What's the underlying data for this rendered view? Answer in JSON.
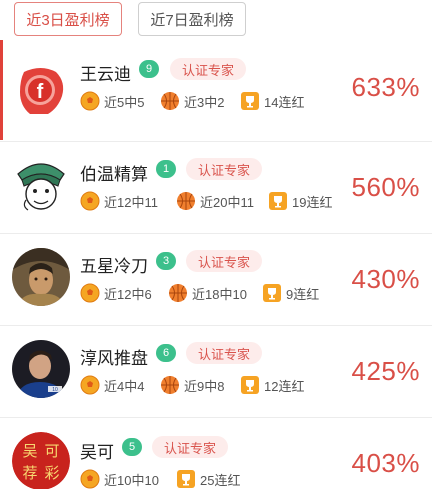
{
  "tabs": [
    {
      "label": "近3日盈利榜",
      "active": true
    },
    {
      "label": "近7日盈利榜",
      "active": false
    }
  ],
  "experts": [
    {
      "name": "王云迪",
      "rank": "9",
      "cert": "认证专家",
      "stat1": "近5中5",
      "stat2": "近3中2",
      "streak": "14连红",
      "rate": "633%",
      "avatar": "red-f-logo"
    },
    {
      "name": "伯温精算",
      "rank": "1",
      "cert": "认证专家",
      "stat1": "近12中11",
      "stat2": "近20中11",
      "streak": "19连红",
      "rate": "560%",
      "avatar": "cartoon-scholar"
    },
    {
      "name": "五星冷刀",
      "rank": "3",
      "cert": "认证专家",
      "stat1": "近12中6",
      "stat2": "近18中10",
      "streak": "9连红",
      "rate": "430%",
      "avatar": "warrior-portrait"
    },
    {
      "name": "淳风推盘",
      "rank": "6",
      "cert": "认证专家",
      "stat1": "近4中4",
      "stat2": "近9中8",
      "streak": "12连红",
      "rate": "425%",
      "avatar": "footballer-photo"
    },
    {
      "name": "吴可",
      "rank": "5",
      "cert": "认证专家",
      "stat1": "近10中10",
      "stat2": "",
      "streak": "25连红",
      "rate": "403%",
      "avatar": "calligraphy-seal",
      "avatar_text": "吴可荐彩"
    }
  ],
  "colors": {
    "accent": "#d94f47",
    "badge_green": "#3cc08c",
    "cert_bg": "#fdeceb"
  }
}
